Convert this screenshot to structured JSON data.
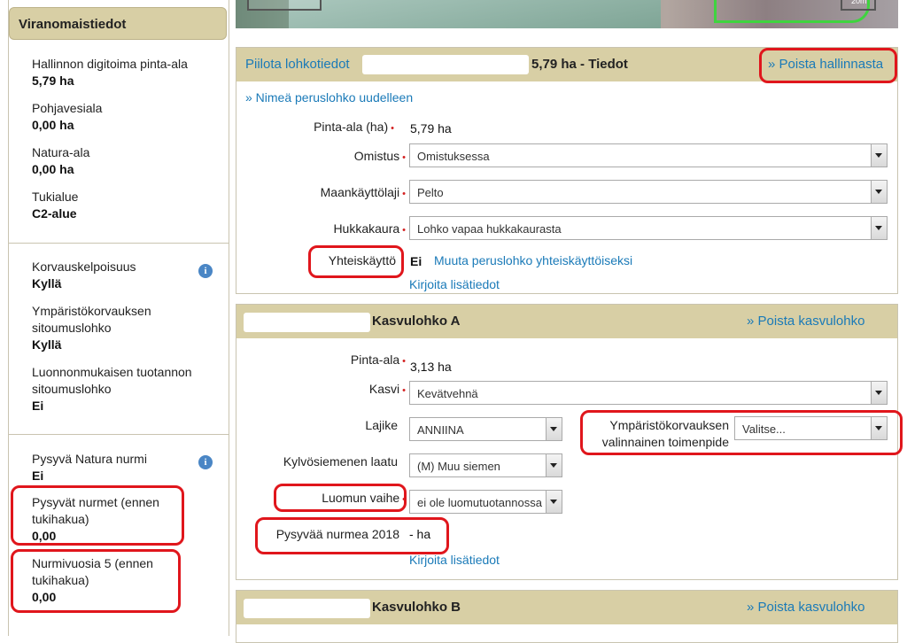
{
  "sidebar": {
    "title": "Viranomaistiedot",
    "items": [
      {
        "label": "Hallinnon digitoima pinta-ala",
        "value": "5,79 ha"
      },
      {
        "label": "Pohjavesiala",
        "value": "0,00 ha"
      },
      {
        "label": "Natura-ala",
        "value": "0,00 ha"
      },
      {
        "label": "Tukialue",
        "value": "C2-alue"
      },
      {
        "label": "Korvauskelpoisuus",
        "value": "Kyllä"
      },
      {
        "label": "Ympäristökorvauksen sitoumuslohko",
        "value": "Kyllä"
      },
      {
        "label": "Luonnonmukaisen tuotannon sitoumuslohko",
        "value": "Ei"
      },
      {
        "label": "Pysyvä Natura nurmi",
        "value": "Ei"
      },
      {
        "label": "Pysyvät nurmet (ennen tukihakua)",
        "value": "0,00"
      },
      {
        "label": "Nurmivuosia 5 (ennen tukihakua)",
        "value": "0,00"
      }
    ],
    "info_icon": "i"
  },
  "map": {
    "scale_text": "20m"
  },
  "lohko_panel": {
    "hide_link": "Piilota lohkotiedot",
    "title": "5,79 ha - Tiedot",
    "remove_link": "» Poista hallinnasta",
    "rename_link": "» Nimeä peruslohko uudelleen",
    "area_label": "Pinta-ala (ha)",
    "area_value": "5,79 ha",
    "ownership_label": "Omistus",
    "ownership_value": "Omistuksessa",
    "landuse_label": "Maankäyttölaji",
    "landuse_value": "Pelto",
    "wildoat_label": "Hukkakaura",
    "wildoat_value": "Lohko vapaa hukkakaurasta",
    "shared_label": "Yhteiskäyttö",
    "shared_value": "Ei",
    "shared_link": "Muuta peruslohko yhteiskäyttöiseksi",
    "notes_link": "Kirjoita lisätiedot"
  },
  "kasvulohko_a": {
    "title": "Kasvulohko A",
    "remove_link": "» Poista kasvulohko",
    "area_label": "Pinta-ala",
    "area_value": "3,13  ha",
    "crop_label": "Kasvi",
    "crop_value": "Kevätvehnä",
    "variety_label": "Lajike",
    "variety_value": "ANNIINA",
    "env_label_line1": "Ympäristökorvauksen",
    "env_label_line2": "valinnainen toimenpide",
    "env_value": "Valitse...",
    "seed_label": "Kylvösiemenen laatu",
    "seed_value": "(M) Muu siemen",
    "organic_label": "Luomun vaihe",
    "organic_value": "ei ole luomutuotannossa",
    "permanent_label": "Pysyvää nurmea 2018",
    "permanent_value": "- ha",
    "notes_link": "Kirjoita lisätiedot"
  },
  "kasvulohko_b": {
    "title": "Kasvulohko B",
    "remove_link": "» Poista kasvulohko"
  }
}
